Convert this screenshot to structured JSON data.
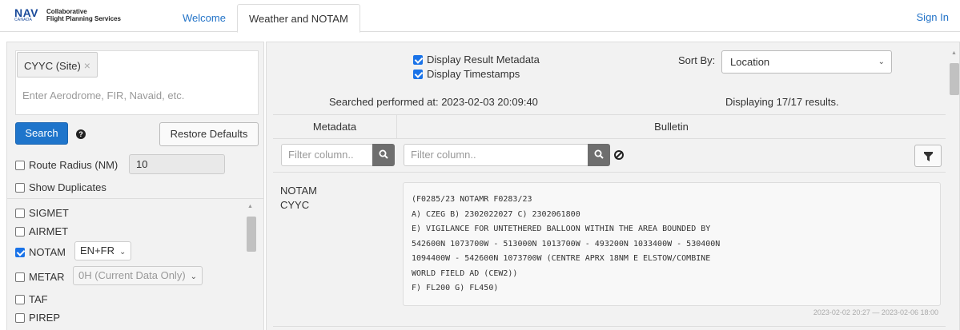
{
  "header": {
    "logo": {
      "nav": "NAV",
      "canada": "CANADA",
      "line1": "Collaborative",
      "line2": "Flight Planning Services"
    },
    "tabs": [
      {
        "label": "Welcome"
      },
      {
        "label": "Weather and NOTAM"
      }
    ],
    "active_tab": "Weather and NOTAM",
    "signin_label": "Sign In"
  },
  "search": {
    "chips": [
      {
        "label": "CYYC (Site)",
        "remove": "×"
      }
    ],
    "placeholder": "Enter Aerodrome, FIR, Navaid, etc.",
    "search_label": "Search",
    "help_label": "?",
    "restore_label": "Restore Defaults"
  },
  "options": {
    "route_radius": {
      "label": "Route Radius (NM)",
      "checked": false,
      "value": "10"
    },
    "show_duplicates": {
      "label": "Show Duplicates",
      "checked": false
    }
  },
  "report_types": [
    {
      "label": "SIGMET",
      "checked": false
    },
    {
      "label": "AIRMET",
      "checked": false
    },
    {
      "label": "NOTAM",
      "checked": true,
      "select": "EN+FR"
    },
    {
      "label": "METAR",
      "checked": false,
      "select": "0H (Current Data Only)"
    },
    {
      "label": "TAF",
      "checked": false
    },
    {
      "label": "PIREP",
      "checked": false
    }
  ],
  "results": {
    "display_metadata_label": "Display Result Metadata",
    "display_timestamps_label": "Display Timestamps",
    "sort_by_label": "Sort By:",
    "sort_by_value": "Location",
    "searched_at": "Searched performed at: 2023-02-03 20:09:40",
    "displaying": "Displaying 17/17 results.",
    "columns": {
      "metadata": "Metadata",
      "bulletin": "Bulletin"
    },
    "filter_placeholder": "Filter column.."
  },
  "items": [
    {
      "type": "NOTAM",
      "location": "CYYC",
      "bulletin": "(F0285/23 NOTAMR F0283/23\nA) CZEG B) 2302022027 C) 2302061800\nE) VIGILANCE FOR UNTETHERED BALLOON WITHIN THE AREA BOUNDED BY\n542600N 1073700W - 513000N 1013700W - 493200N 1033400W - 530400N\n1094400W - 542600N 1073700W (CENTRE APRX 18NM E ELSTOW/COMBINE\nWORLD FIELD AD (CEW2))\nF) FL200 G) FL450)",
      "timestamp": "2023-02-02 20:27 — 2023-02-06 18:00"
    }
  ],
  "colors": {
    "accent": "#1f75cb",
    "link": "#2474c8",
    "panel": "#f2f2f2"
  }
}
